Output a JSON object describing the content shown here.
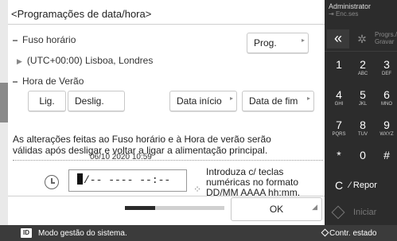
{
  "title": "<Programações de data/hora>",
  "timezone": {
    "label": "Fuso horário",
    "value": "(UTC+00:00) Lisboa, Londres",
    "prog_button": "Prog."
  },
  "dst": {
    "label": "Hora de Verão",
    "on_button": "Lig.",
    "off_button": "Deslig.",
    "start_button": "Data início",
    "end_button": "Data de fim"
  },
  "info_text_1": "As alterações feitas ao Fuso horário e à Hora de verão serão",
  "info_text_2": "válidas após desligar e voltar a ligar a alimentação principal.",
  "current_datetime": "06/10 2020 10:59",
  "input_value": "/-- ---- --:--",
  "hint_1": "Introduza c/ teclas",
  "hint_2": "numéricas no formato",
  "hint_3": "DD/MM AAAA hh:mm.",
  "ok_button": "OK",
  "progress_fraction": 0.3,
  "status": {
    "id_badge": "ID",
    "message": "Modo gestão do sistema.",
    "right": "Contr. estado"
  },
  "keypad": {
    "admin_label": "Administrator",
    "admin_sub": "Enc.ses",
    "back": "«",
    "progs_1": "Progrs./",
    "progs_2": "Gravar",
    "keys": [
      {
        "num": "1",
        "letters": ""
      },
      {
        "num": "2",
        "letters": "ABC"
      },
      {
        "num": "3",
        "letters": "DEF"
      },
      {
        "num": "4",
        "letters": "GHI"
      },
      {
        "num": "5",
        "letters": "JKL"
      },
      {
        "num": "6",
        "letters": "MNO"
      },
      {
        "num": "7",
        "letters": "PQRS"
      },
      {
        "num": "8",
        "letters": "TUV"
      },
      {
        "num": "9",
        "letters": "WXYZ"
      },
      {
        "num": "*",
        "letters": ""
      },
      {
        "num": "0",
        "letters": ""
      },
      {
        "num": "#",
        "letters": ""
      }
    ],
    "clear": "C",
    "repor": "⁄ Repor",
    "start": "Iniciar"
  }
}
